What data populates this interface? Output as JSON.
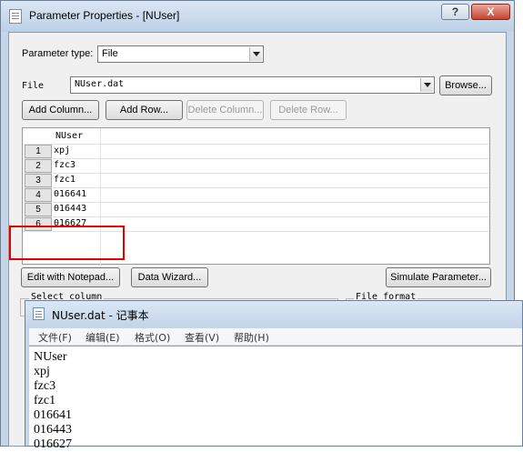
{
  "dialog": {
    "title": "Parameter Properties - [NUser]",
    "help_btn": "?",
    "close_btn": "X",
    "param_type_label": "Parameter type:",
    "param_type_value": "File",
    "file_label": "File",
    "file_value": "NUser.dat",
    "browse_btn": "Browse...",
    "add_column_btn": "Add Column...",
    "add_row_btn": "Add Row...",
    "delete_column_btn": "Delete Column...",
    "delete_row_btn": "Delete Row...",
    "grid": {
      "column_header": "NUser",
      "rows": [
        {
          "num": "1",
          "value": "xpj"
        },
        {
          "num": "2",
          "value": "fzc3"
        },
        {
          "num": "3",
          "value": "fzc1"
        },
        {
          "num": "4",
          "value": "016641"
        },
        {
          "num": "5",
          "value": "016443"
        },
        {
          "num": "6",
          "value": "016627"
        }
      ]
    },
    "edit_notepad_btn": "Edit with Notepad...",
    "data_wizard_btn": "Data Wizard...",
    "simulate_btn": "Simulate Parameter...",
    "select_column_label": "Select column",
    "file_format_label": "File format",
    "highlight_color": "#e60000"
  },
  "notepad": {
    "title": "NUser.dat - 记事本",
    "menu": [
      "文件(F)",
      "编辑(E)",
      "格式(O)",
      "查看(V)",
      "帮助(H)"
    ],
    "lines": [
      "NUser",
      "xpj",
      "fzc3",
      "fzc1",
      "016641",
      "016443",
      "016627"
    ]
  }
}
